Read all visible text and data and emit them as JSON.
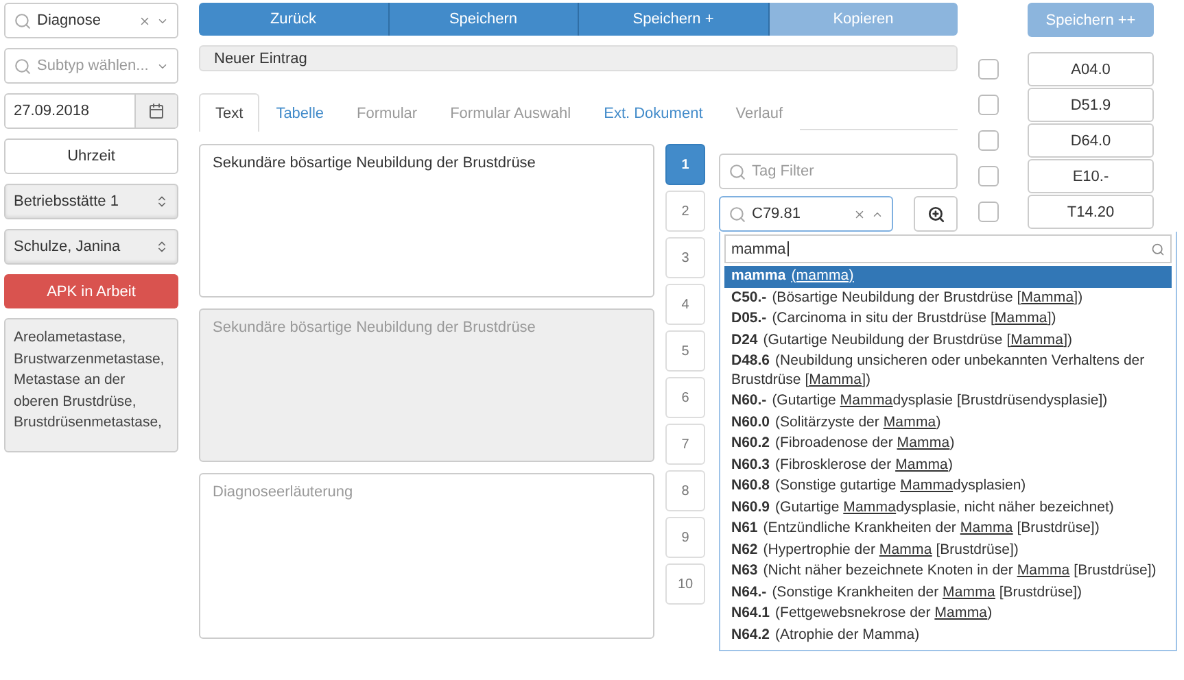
{
  "sidebar": {
    "type_select": {
      "value": "Diagnose"
    },
    "subtype_select": {
      "placeholder": "Subtyp wählen..."
    },
    "date_field": {
      "value": "27.09.2018"
    },
    "time_button": "Uhrzeit",
    "location_select": {
      "value": "Betriebsstätte 1"
    },
    "user_select": {
      "value": "Schulze, Janina"
    },
    "status_button": "APK in Arbeit",
    "notes": [
      "Areolametastase,",
      "Brustwarzenmetastase,",
      "Metastase an der",
      "oberen Brustdrüse,",
      "Brustdrüsenmetastase,"
    ]
  },
  "toolbar": [
    {
      "label": "Zurück",
      "disabled": false
    },
    {
      "label": "Speichern",
      "disabled": false
    },
    {
      "label": "Speichern +",
      "disabled": false
    },
    {
      "label": "Kopieren",
      "disabled": true
    }
  ],
  "extra_button": {
    "label": "Speichern ++",
    "disabled": true
  },
  "entry_bar": "Neuer Eintrag",
  "tabs": [
    {
      "label": "Text",
      "selected": true,
      "disabled": false
    },
    {
      "label": "Tabelle",
      "selected": false,
      "disabled": false
    },
    {
      "label": "Formular",
      "selected": false,
      "disabled": true
    },
    {
      "label": "Formular Auswahl",
      "selected": false,
      "disabled": true
    },
    {
      "label": "Ext. Dokument",
      "selected": false,
      "disabled": false
    },
    {
      "label": "Verlauf",
      "selected": false,
      "disabled": true
    }
  ],
  "text_areas": [
    {
      "value": "Sekundäre bösartige Neubildung der Brustdrüse",
      "disabled": false
    },
    {
      "value": "Sekundäre bösartige Neubildung der Brustdrüse",
      "disabled": true
    },
    {
      "placeholder": "Diagnoseerläuterung",
      "disabled": false
    }
  ],
  "pages": [
    {
      "label": "1",
      "selected": true
    },
    {
      "label": "2",
      "selected": false
    },
    {
      "label": "3",
      "selected": false
    },
    {
      "label": "4",
      "selected": false
    },
    {
      "label": "5",
      "selected": false
    },
    {
      "label": "6",
      "selected": false
    },
    {
      "label": "7",
      "selected": false
    },
    {
      "label": "8",
      "selected": false
    },
    {
      "label": "9",
      "selected": false
    },
    {
      "label": "10",
      "selected": false
    }
  ],
  "tag_filter": {
    "placeholder": "Tag Filter"
  },
  "code_select": {
    "value": "C79.81",
    "expanded": true
  },
  "dropdown": {
    "search": "mamma",
    "options": [
      {
        "code": "mamma",
        "selected": true,
        "description": [
          {
            "text": "(mamma)",
            "underlined": true
          }
        ]
      },
      {
        "code": "C50.-",
        "selected": false,
        "description": [
          {
            "text": "(Bösartige Neubildung der Brustdrüse [",
            "underlined": false
          },
          {
            "text": "Mamma",
            "underlined": true
          },
          {
            "text": "])",
            "underlined": false
          }
        ]
      },
      {
        "code": "D05.-",
        "selected": false,
        "description": [
          {
            "text": "(Carcinoma in situ der Brustdrüse [",
            "underlined": false
          },
          {
            "text": "Mamma",
            "underlined": true
          },
          {
            "text": "])",
            "underlined": false
          }
        ]
      },
      {
        "code": "D24",
        "selected": false,
        "description": [
          {
            "text": "(Gutartige Neubildung der Brustdrüse [",
            "underlined": false
          },
          {
            "text": "Mamma",
            "underlined": true
          },
          {
            "text": "])",
            "underlined": false
          }
        ]
      },
      {
        "code": "D48.6",
        "selected": false,
        "description": [
          {
            "text": "(Neubildung unsicheren oder unbekannten Verhaltens der Brustdrüse [",
            "underlined": false
          },
          {
            "text": "Mamma",
            "underlined": true
          },
          {
            "text": "])",
            "underlined": false
          }
        ]
      },
      {
        "code": "N60.-",
        "selected": false,
        "description": [
          {
            "text": "(Gutartige ",
            "underlined": false
          },
          {
            "text": "Mamma",
            "underlined": true
          },
          {
            "text": "dysplasie [Brustdrüsendysplasie])",
            "underlined": false
          }
        ]
      },
      {
        "code": "N60.0",
        "selected": false,
        "description": [
          {
            "text": "(Solitärzyste der ",
            "underlined": false
          },
          {
            "text": "Mamma",
            "underlined": true
          },
          {
            "text": ")",
            "underlined": false
          }
        ]
      },
      {
        "code": "N60.2",
        "selected": false,
        "description": [
          {
            "text": "(Fibroadenose der ",
            "underlined": false
          },
          {
            "text": "Mamma",
            "underlined": true
          },
          {
            "text": ")",
            "underlined": false
          }
        ]
      },
      {
        "code": "N60.3",
        "selected": false,
        "description": [
          {
            "text": "(Fibrosklerose der ",
            "underlined": false
          },
          {
            "text": "Mamma",
            "underlined": true
          },
          {
            "text": ")",
            "underlined": false
          }
        ]
      },
      {
        "code": "N60.8",
        "selected": false,
        "description": [
          {
            "text": "(Sonstige gutartige ",
            "underlined": false
          },
          {
            "text": "Mamma",
            "underlined": true
          },
          {
            "text": "dysplasien)",
            "underlined": false
          }
        ]
      },
      {
        "code": "N60.9",
        "selected": false,
        "description": [
          {
            "text": "(Gutartige ",
            "underlined": false
          },
          {
            "text": "Mamma",
            "underlined": true
          },
          {
            "text": "dysplasie, nicht näher bezeichnet)",
            "underlined": false
          }
        ]
      },
      {
        "code": "N61",
        "selected": false,
        "description": [
          {
            "text": "(Entzündliche Krankheiten der ",
            "underlined": false
          },
          {
            "text": "Mamma",
            "underlined": true
          },
          {
            "text": " [Brustdrüse])",
            "underlined": false
          }
        ]
      },
      {
        "code": "N62",
        "selected": false,
        "description": [
          {
            "text": "(Hypertrophie der ",
            "underlined": false
          },
          {
            "text": "Mamma",
            "underlined": true
          },
          {
            "text": " [Brustdrüse])",
            "underlined": false
          }
        ]
      },
      {
        "code": "N63",
        "selected": false,
        "description": [
          {
            "text": "(Nicht näher bezeichnete Knoten in der ",
            "underlined": false
          },
          {
            "text": "Mamma",
            "underlined": true
          },
          {
            "text": " [Brustdrüse])",
            "underlined": false
          }
        ]
      },
      {
        "code": "N64.-",
        "selected": false,
        "description": [
          {
            "text": "(Sonstige Krankheiten der ",
            "underlined": false
          },
          {
            "text": "Mamma",
            "underlined": true
          },
          {
            "text": " [Brustdrüse])",
            "underlined": false
          }
        ]
      },
      {
        "code": "N64.1",
        "selected": false,
        "description": [
          {
            "text": "(Fettgewebsnekrose der ",
            "underlined": false
          },
          {
            "text": "Mamma",
            "underlined": true
          },
          {
            "text": ")",
            "underlined": false
          }
        ]
      },
      {
        "code": "N64.2",
        "selected": false,
        "description": [
          {
            "text": "(Atrophie der Mamma)",
            "underlined": false
          }
        ]
      }
    ]
  },
  "code_list": [
    {
      "code": "A04.0",
      "checked": false
    },
    {
      "code": "D51.9",
      "checked": false
    },
    {
      "code": "D64.0",
      "checked": false
    },
    {
      "code": "E10.-",
      "checked": false
    },
    {
      "code": "T14.20",
      "checked": false
    }
  ]
}
